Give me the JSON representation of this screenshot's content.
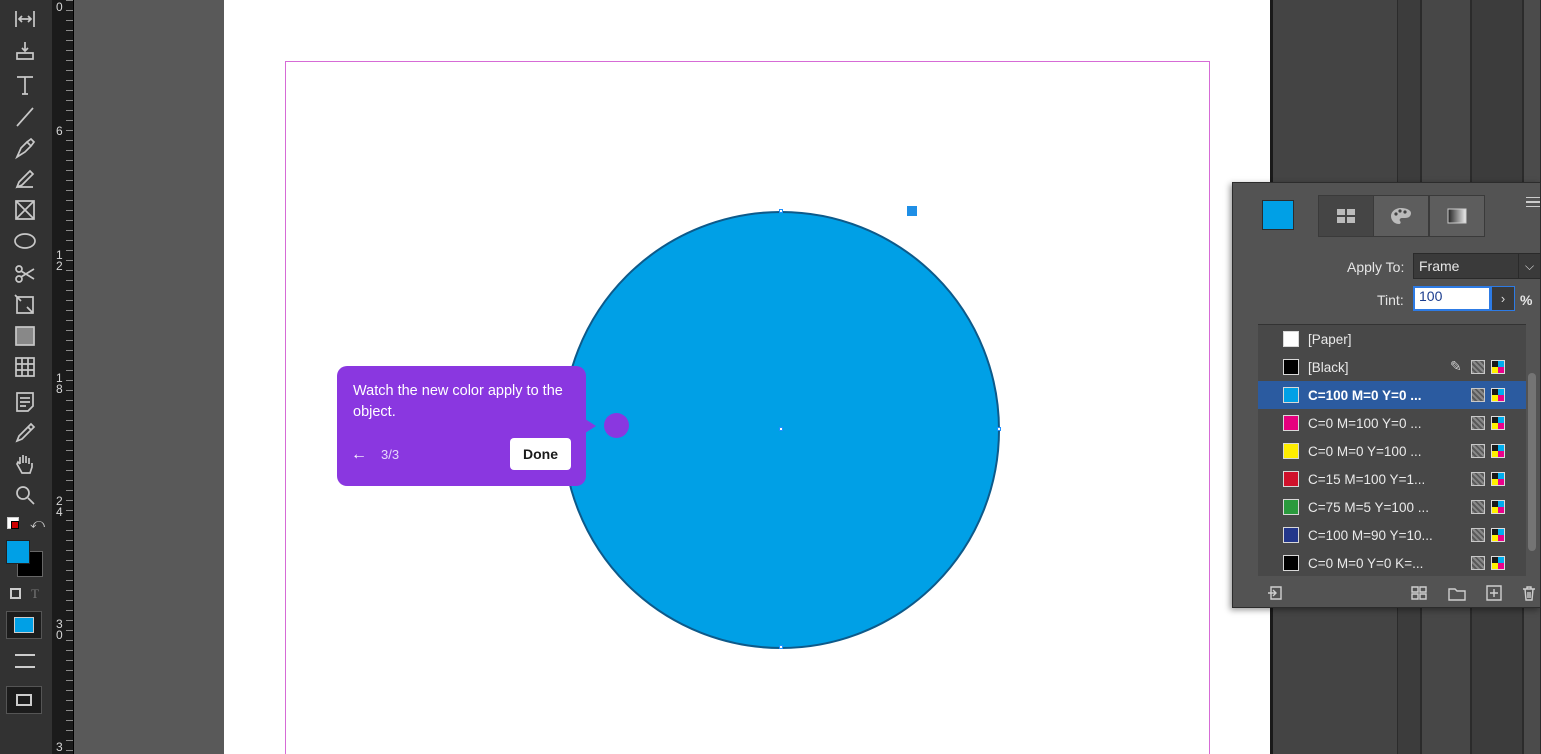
{
  "ruler": {
    "marks": [
      {
        "label": "0"
      },
      {
        "label": "6"
      },
      {
        "label": "12"
      },
      {
        "label": "18"
      },
      {
        "label": "24"
      },
      {
        "label": "30"
      },
      {
        "label": "3"
      }
    ]
  },
  "tools": [
    {
      "name": "gap-tool-icon"
    },
    {
      "name": "content-collector-icon"
    },
    {
      "name": "type-tool-icon"
    },
    {
      "name": "line-tool-icon"
    },
    {
      "name": "pen-tool-icon"
    },
    {
      "name": "pencil-tool-icon"
    },
    {
      "name": "rectangle-frame-tool-icon"
    },
    {
      "name": "ellipse-tool-icon"
    },
    {
      "name": "scissors-tool-icon"
    },
    {
      "name": "free-transform-tool-icon"
    },
    {
      "name": "gradient-swatch-tool-icon"
    },
    {
      "name": "gradient-feather-tool-icon"
    },
    {
      "name": "note-tool-icon"
    },
    {
      "name": "eyedropper-tool-icon"
    },
    {
      "name": "hand-tool-icon"
    },
    {
      "name": "zoom-tool-icon"
    }
  ],
  "fill_color": "#00a0e6",
  "coach": {
    "message": "Watch the new color apply to the object.",
    "back": "←",
    "step": "3/3",
    "done_label": "Done"
  },
  "swatches_panel": {
    "apply_to_label": "Apply To:",
    "apply_to_value": "Frame",
    "tint_label": "Tint:",
    "tint_value": "100",
    "tint_unit": "%",
    "items": [
      {
        "name": "[Paper]",
        "color": "#ffffff",
        "selected": false,
        "icons": []
      },
      {
        "name": "[Black]",
        "color": "#000000",
        "selected": false,
        "icons": [
          "no-edit",
          "process",
          "cmyk"
        ]
      },
      {
        "name": "C=100 M=0 Y=0 ...",
        "color": "#00a0e6",
        "selected": true,
        "icons": [
          "process",
          "cmyk"
        ]
      },
      {
        "name": "C=0 M=100 Y=0 ...",
        "color": "#e6007e",
        "selected": false,
        "icons": [
          "process",
          "cmyk"
        ]
      },
      {
        "name": "C=0 M=0 Y=100 ...",
        "color": "#ffed00",
        "selected": false,
        "icons": [
          "process",
          "cmyk"
        ]
      },
      {
        "name": "C=15 M=100 Y=1...",
        "color": "#d0112b",
        "selected": false,
        "icons": [
          "process",
          "cmyk"
        ]
      },
      {
        "name": "C=75 M=5 Y=100 ...",
        "color": "#2a9a3d",
        "selected": false,
        "icons": [
          "process",
          "cmyk"
        ]
      },
      {
        "name": "C=100 M=90 Y=10...",
        "color": "#23378b",
        "selected": false,
        "icons": [
          "process",
          "cmyk"
        ]
      },
      {
        "name": "C=0 M=0 Y=0 K=...",
        "color": "#000000",
        "selected": false,
        "icons": [
          "process",
          "cmyk"
        ]
      }
    ]
  }
}
